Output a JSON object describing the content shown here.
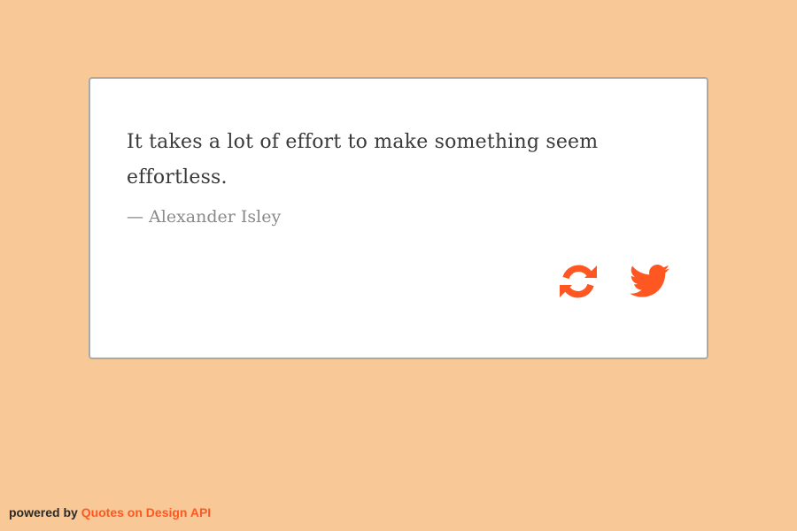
{
  "quote": {
    "text": "It takes a lot of effort to make something seem effortless.",
    "author": "— Alexander Isley"
  },
  "actions": {
    "refresh_icon": "refresh-icon",
    "tweet_icon": "twitter-icon"
  },
  "footer": {
    "prefix": "powered by ",
    "link_label": "Quotes on Design API"
  },
  "colors": {
    "background": "#f8c997",
    "accent": "#ff5722",
    "card": "#ffffff",
    "text": "#3a3a3a",
    "author": "#8a8a8a"
  }
}
